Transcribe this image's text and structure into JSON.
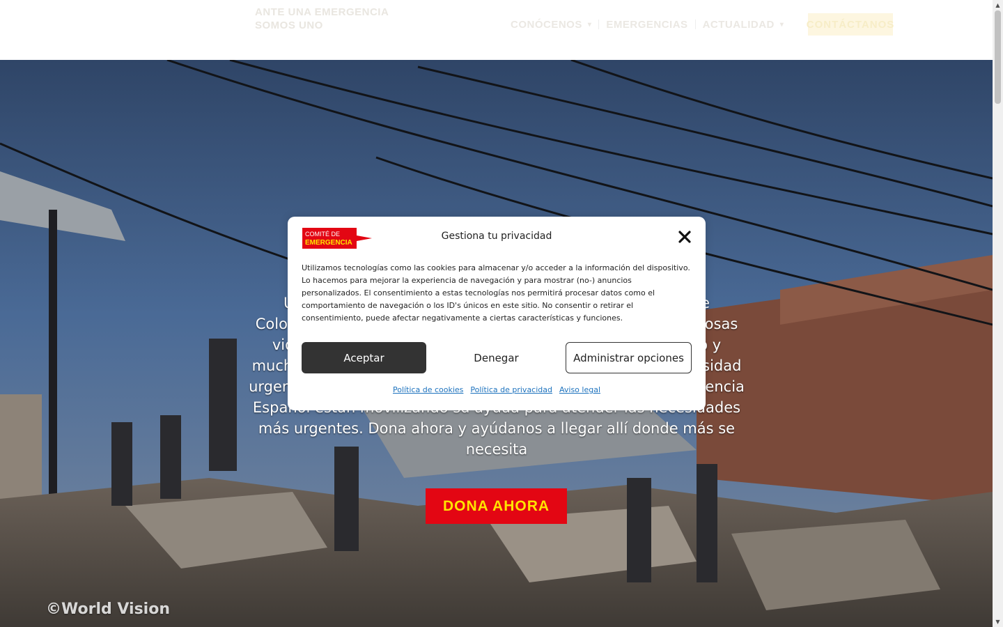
{
  "header": {
    "tagline": "ANTE UNA EMERGENCIA SOMOS UNO",
    "nav": [
      {
        "label": "CONÓCENOS",
        "has_dropdown": true
      },
      {
        "label": "EMERGENCIAS",
        "has_dropdown": false
      },
      {
        "label": "ACTUALIDAD",
        "has_dropdown": true
      }
    ],
    "contact_label": "CONTÁCTANOS"
  },
  "hero": {
    "text": "Un terremoto ha golpeado a Colombia y Perú, en el sur de Colombia, dejando a miles de personas desplazadas y numerosas vidas perdidas. Centenares de edificios se han derrumbado y muchas casas familiares han quedado inhabitables, con necesidad urgente de ayuda y protección. Las ONG del Comité de Emergencia Español están movilizando su ayuda para atender las necesidades más urgentes. Dona ahora y ayúdanos a llegar allí donde más se necesita",
    "donate_label": "DONA AHORA",
    "photo_credit": "©World Vision"
  },
  "cookie_modal": {
    "logo_line1": "COMITÉ DE",
    "logo_line2": "EMERGENCIA",
    "title": "Gestiona tu privacidad",
    "body": "Utilizamos tecnologías como las cookies para almacenar y/o acceder a la información del dispositivo. Lo hacemos para mejorar la experiencia de navegación y para mostrar (no-) anuncios personalizados. El consentimiento a estas tecnologías nos permitirá procesar datos como el comportamiento de navegación o los ID's únicos en este sitio. No consentir o retirar el consentimiento, puede afectar negativamente a ciertas características y funciones.",
    "accept_label": "Aceptar",
    "deny_label": "Denegar",
    "manage_label": "Administrar opciones",
    "links": [
      "Política de cookies",
      "Política de privacidad",
      "Aviso legal"
    ]
  },
  "colors": {
    "brand_red": "#e30613",
    "brand_yellow": "#ffe400",
    "accept_bg": "#333333",
    "link": "#1e73be"
  },
  "icons": {
    "close": "close-icon",
    "dropdown": "chevron-down-icon"
  }
}
